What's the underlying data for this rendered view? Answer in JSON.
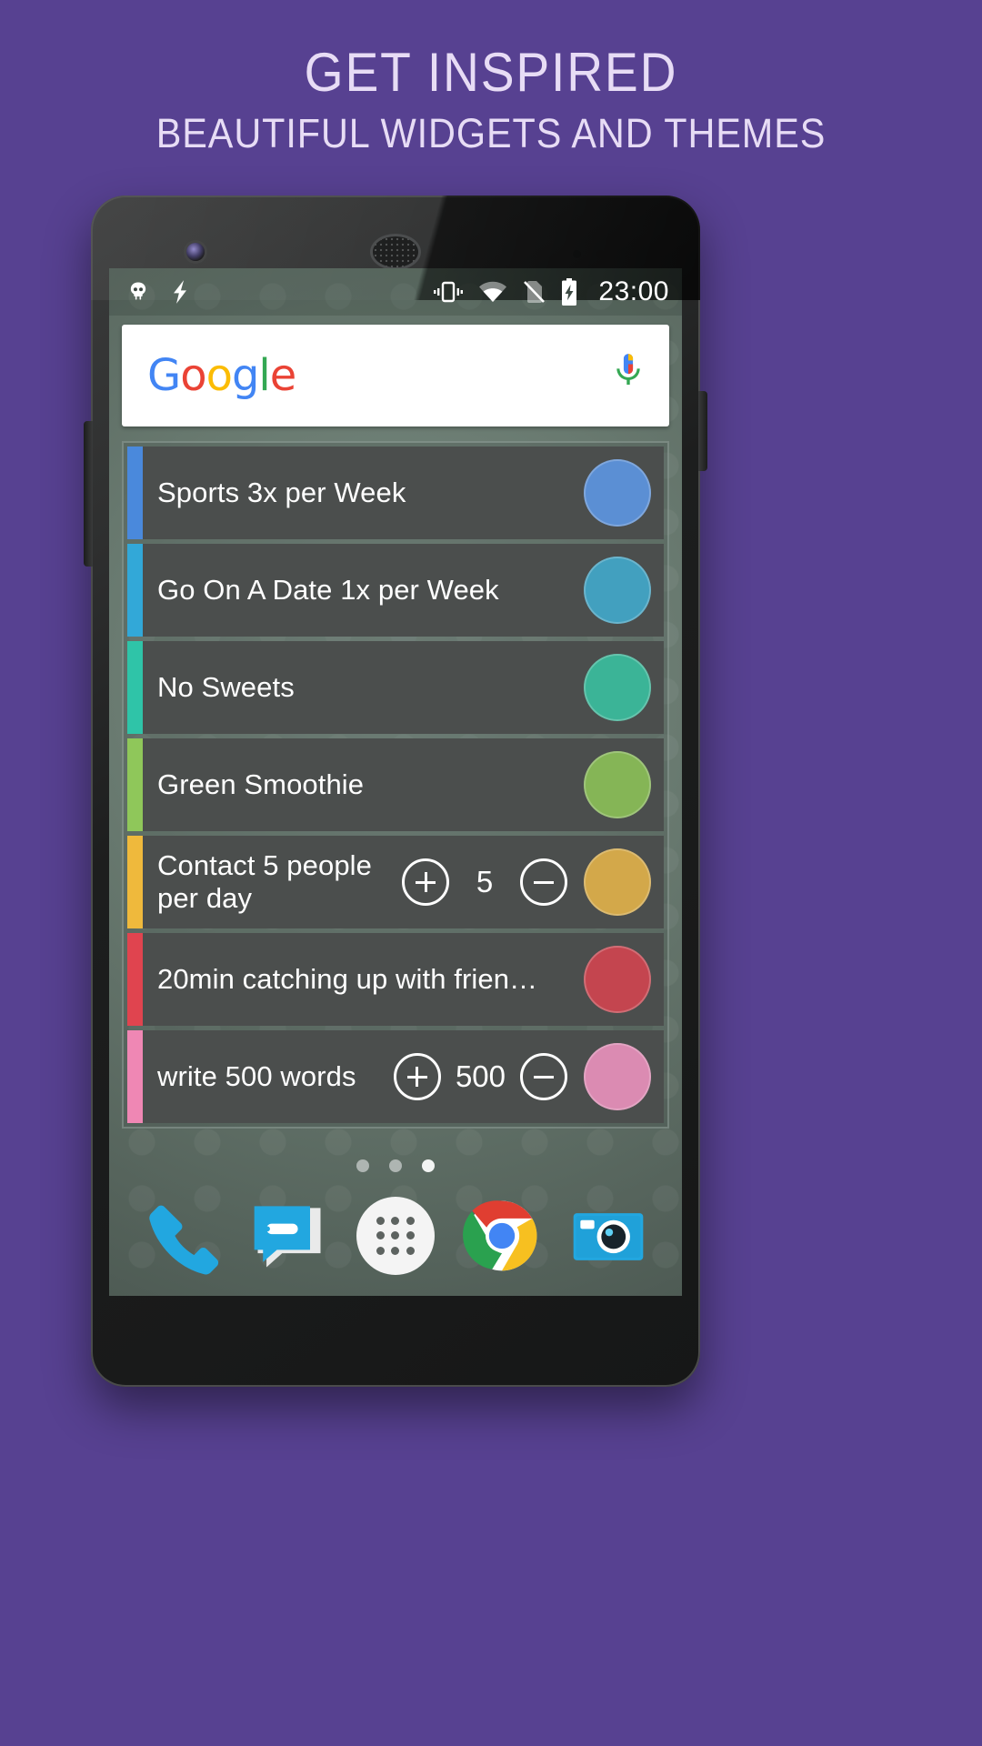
{
  "promo": {
    "title": "GET INSPIRED",
    "subtitle": "BEAUTIFUL WIDGETS AND THEMES",
    "background_color": "#574191",
    "text_color": "#e7dcf5"
  },
  "status_bar": {
    "time": "23:00",
    "icons": [
      {
        "name": "cyanogenmod-skull-icon",
        "position": "left"
      },
      {
        "name": "lightning-bolt-icon",
        "position": "left"
      },
      {
        "name": "vibrate-icon",
        "position": "right"
      },
      {
        "name": "wifi-icon",
        "position": "right"
      },
      {
        "name": "no-sim-icon",
        "position": "right"
      },
      {
        "name": "battery-charging-icon",
        "position": "right"
      }
    ]
  },
  "search_bar": {
    "logo_letters": [
      "G",
      "o",
      "o",
      "g",
      "l",
      "e"
    ],
    "logo_colors": [
      "#4285F4",
      "#EA4335",
      "#FBBC05",
      "#4285F4",
      "#34A853",
      "#EA4335"
    ],
    "mic_icon": "microphone-icon"
  },
  "widget": {
    "rows": [
      {
        "label": "Sports 3x per Week",
        "bar_color": "#4a89dc",
        "dot_color": "#5b8fd4",
        "has_stepper": false,
        "count": null
      },
      {
        "label": "Go On A Date 1x per Week",
        "bar_color": "#32a8d8",
        "dot_color": "#42a0bf",
        "has_stepper": false,
        "count": null
      },
      {
        "label": "No Sweets",
        "bar_color": "#2fc4a8",
        "dot_color": "#3bb497",
        "has_stepper": false,
        "count": null
      },
      {
        "label": "Green Smoothie",
        "bar_color": "#8fc75a",
        "dot_color": "#85b556",
        "has_stepper": false,
        "count": null
      },
      {
        "label": "Contact 5 people\nper day",
        "bar_color": "#efb93c",
        "dot_color": "#d3a84a",
        "has_stepper": true,
        "count": "5"
      },
      {
        "label": "20min catching up with frien…",
        "bar_color": "#e0444f",
        "dot_color": "#c4454f",
        "has_stepper": false,
        "count": null
      },
      {
        "label": "write 500 words",
        "bar_color": "#ef87b4",
        "dot_color": "#db8bb2",
        "has_stepper": true,
        "count": "500"
      }
    ],
    "stepper": {
      "increment_label": "+",
      "decrement_label": "−"
    }
  },
  "page_indicator": {
    "total": 3,
    "active_index": 2
  },
  "dock": {
    "items": [
      {
        "name": "phone-icon",
        "label": "Phone"
      },
      {
        "name": "messages-icon",
        "label": "Messages"
      },
      {
        "name": "app-drawer-icon",
        "label": "All Apps"
      },
      {
        "name": "chrome-icon",
        "label": "Chrome"
      },
      {
        "name": "camera-icon",
        "label": "Camera"
      }
    ]
  }
}
